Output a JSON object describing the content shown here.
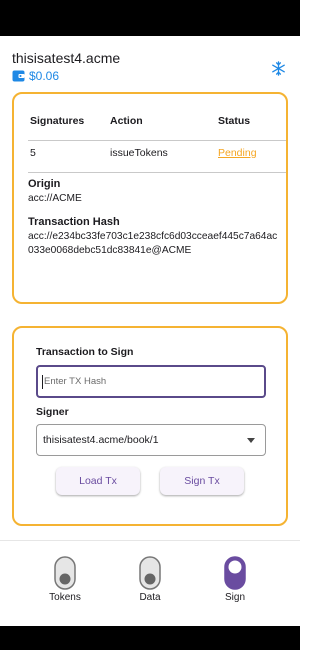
{
  "account": {
    "name": "thisisatest4.acme",
    "balance": "$0.06"
  },
  "icons": {
    "wallet": "wallet-icon",
    "network": "snowflake-icon"
  },
  "colors": {
    "accent_border": "#f5b332",
    "pending": "#f5a623",
    "link_blue": "#1e88e5",
    "button_text": "#6a4ca0"
  },
  "transaction": {
    "table": {
      "headers": [
        "Signatures",
        "Action",
        "Status"
      ],
      "row": {
        "signatures": "5",
        "action": "issueTokens",
        "status": "Pending"
      }
    },
    "origin_label": "Origin",
    "origin_value": "acc://ACME",
    "hash_label": "Transaction Hash",
    "hash_value": "acc://e234bc33fe703c1e238cfc6d03cceaef445c7a64ac033e0068debc51dc83841e@ACME"
  },
  "sign_form": {
    "tx_label": "Transaction to Sign",
    "tx_placeholder": "Enter TX Hash",
    "tx_value": "",
    "signer_label": "Signer",
    "signer_value": "thisisatest4.acme/book/1",
    "load_button": "Load Tx",
    "sign_button": "Sign Tx"
  },
  "nav": {
    "items": [
      {
        "label": "Tokens",
        "active": false
      },
      {
        "label": "Data",
        "active": false
      },
      {
        "label": "Sign",
        "active": true
      }
    ]
  }
}
